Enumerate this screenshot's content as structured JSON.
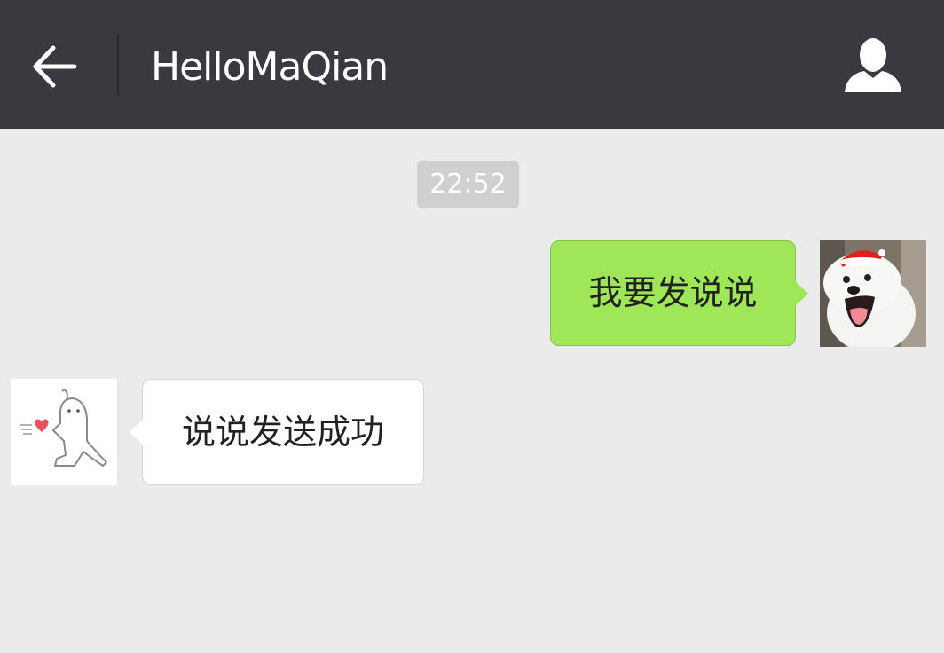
{
  "header": {
    "title": "HelloMaQian",
    "back_icon": "arrow-left-icon",
    "profile_icon": "user-profile-icon",
    "background": "#393a3f"
  },
  "chat": {
    "background": "#ebebeb",
    "timestamp": "22:52",
    "messages": [
      {
        "direction": "outgoing",
        "text": "我要发说说",
        "avatar": "samoyed-dog-santa-hat-avatar",
        "bubble_color": "#9fe658"
      },
      {
        "direction": "incoming",
        "text": "说说发送成功",
        "avatar": "cartoon-character-heart-avatar",
        "bubble_color": "#ffffff"
      }
    ]
  }
}
